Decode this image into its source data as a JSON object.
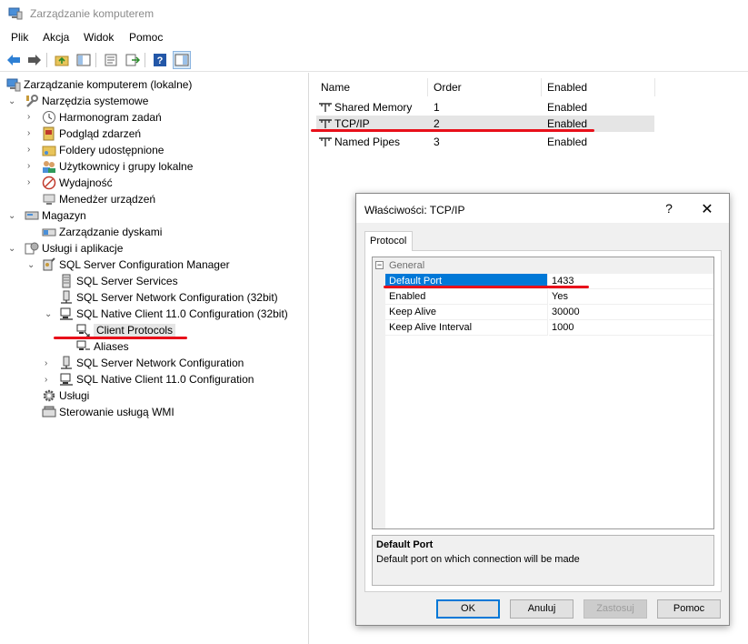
{
  "window": {
    "title": "Zarządzanie komputerem"
  },
  "menu": [
    "Plik",
    "Akcja",
    "Widok",
    "Pomoc"
  ],
  "tree": {
    "root": "Zarządzanie komputerem (lokalne)",
    "system_tools": "Narzędzia systemowe",
    "task_scheduler": "Harmonogram zadań",
    "event_viewer": "Podgląd zdarzeń",
    "shared_folders": "Foldery udostępnione",
    "local_users": "Użytkownicy i grupy lokalne",
    "performance": "Wydajność",
    "device_manager": "Menedżer urządzeń",
    "storage": "Magazyn",
    "disk_management": "Zarządzanie dyskami",
    "services_apps": "Usługi i aplikacje",
    "sql_config_manager": "SQL Server Configuration Manager",
    "sql_services": "SQL Server Services",
    "sql_netconfig_32": "SQL Server Network Configuration (32bit)",
    "sql_native_32": "SQL Native Client 11.0 Configuration (32bit)",
    "client_protocols": "Client Protocols",
    "aliases": "Aliases",
    "sql_netconfig": "SQL Server Network Configuration",
    "sql_native": "SQL Native Client 11.0 Configuration",
    "services": "Usługi",
    "wmi_control": "Sterowanie usługą WMI"
  },
  "list": {
    "columns": [
      "Name",
      "Order",
      "Enabled"
    ],
    "rows": [
      {
        "name": "Shared Memory",
        "order": "1",
        "enabled": "Enabled"
      },
      {
        "name": "TCP/IP",
        "order": "2",
        "enabled": "Enabled"
      },
      {
        "name": "Named Pipes",
        "order": "3",
        "enabled": "Enabled"
      }
    ]
  },
  "dialog": {
    "title": "Właściwości: TCP/IP",
    "help": "?",
    "close": "✕",
    "tab": "Protocol",
    "category": "General",
    "category_toggle": "−",
    "properties": [
      {
        "name": "Default Port",
        "value": "1433"
      },
      {
        "name": "Enabled",
        "value": "Yes"
      },
      {
        "name": "Keep Alive",
        "value": "30000"
      },
      {
        "name": "Keep Alive Interval",
        "value": "1000"
      }
    ],
    "desc_title": "Default Port",
    "desc_text": "Default port on which connection will be made",
    "buttons": {
      "ok": "OK",
      "cancel": "Anuluj",
      "apply": "Zastosuj",
      "help": "Pomoc"
    }
  },
  "colors": {
    "selection": "#0078d7",
    "annotation_red": "#e8101a"
  }
}
